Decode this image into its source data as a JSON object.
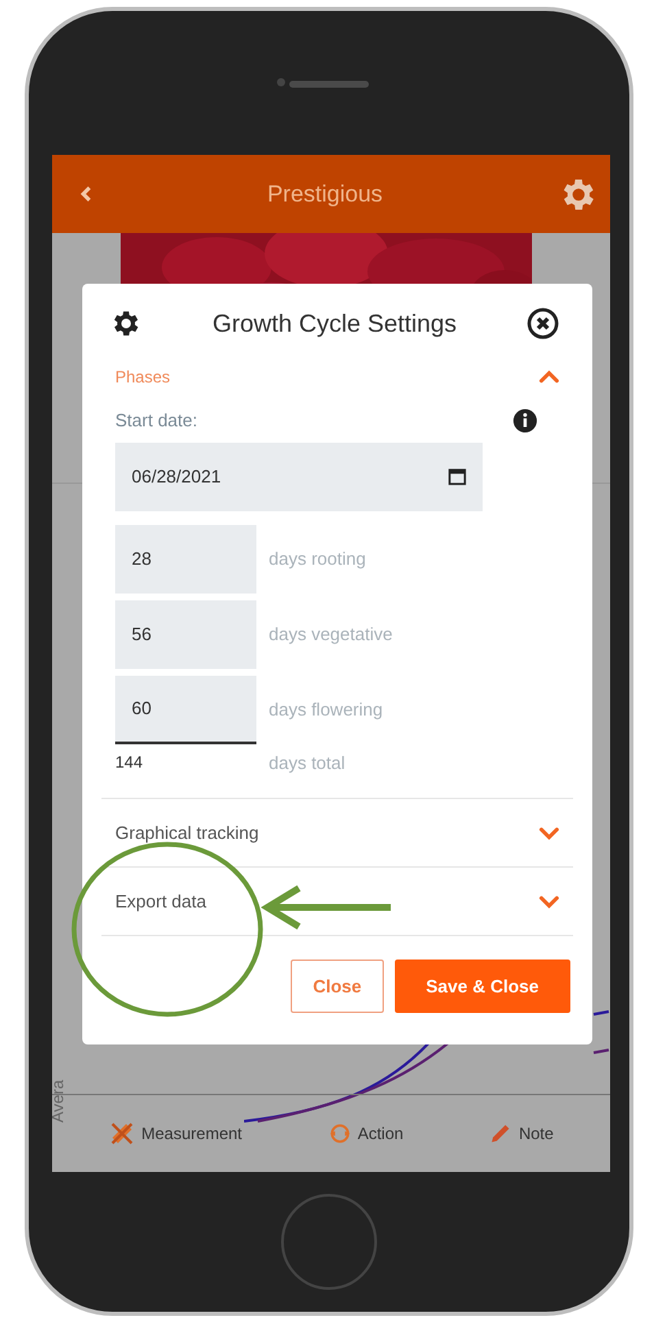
{
  "header": {
    "title": "Prestigious"
  },
  "background": {
    "axis_label": "Avera"
  },
  "modal": {
    "title": "Growth Cycle Settings",
    "sections": [
      {
        "title": "Phases",
        "expanded": true
      },
      {
        "title": "Graphical tracking",
        "expanded": false
      },
      {
        "title": "Export data",
        "expanded": false
      }
    ],
    "start_date": {
      "label": "Start date:",
      "value": "06/28/2021"
    },
    "phases": [
      {
        "value": "28",
        "label": "days rooting"
      },
      {
        "value": "56",
        "label": "days vegetative"
      },
      {
        "value": "60",
        "label": "days flowering"
      }
    ],
    "total": {
      "value": "144",
      "label": "days total"
    },
    "buttons": [
      {
        "label": "Close",
        "kind": "secondary"
      },
      {
        "label": "Save & Close",
        "kind": "primary"
      }
    ]
  },
  "footer": [
    {
      "label": "Measurement",
      "kind": "measurement"
    },
    {
      "label": "Action",
      "kind": "action"
    },
    {
      "label": "Note",
      "kind": "note"
    }
  ]
}
